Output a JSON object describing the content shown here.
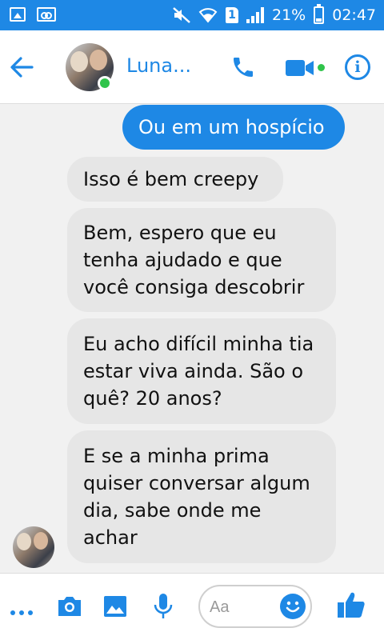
{
  "status_bar": {
    "battery": "21%",
    "time": "02:47",
    "sim_slot": "1"
  },
  "header": {
    "contact_name": "Luna...",
    "accent_color": "#1e88e5",
    "online_color": "#30c44b"
  },
  "messages": [
    {
      "direction": "outgoing",
      "text": "Ou em um hospício"
    },
    {
      "direction": "incoming",
      "text": "Isso é bem creepy"
    },
    {
      "direction": "incoming",
      "text": "Bem, espero que eu tenha ajudado e que você consiga descobrir"
    },
    {
      "direction": "incoming",
      "text": "Eu acho difícil minha tia estar viva ainda. São o quê? 20 anos?"
    },
    {
      "direction": "incoming",
      "text": "E se a minha prima quiser conversar algum dia, sabe onde me achar"
    }
  ],
  "composer": {
    "placeholder": "Aa",
    "icons": [
      "more-icon",
      "camera-icon",
      "gallery-icon",
      "mic-icon",
      "emoji-icon",
      "thumbs-up-icon"
    ]
  }
}
